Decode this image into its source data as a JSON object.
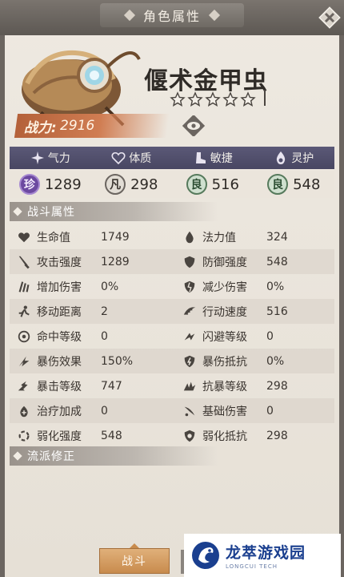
{
  "header": {
    "title": "角色属性"
  },
  "hero": {
    "name": "偃术金甲虫",
    "power_label": "战力:",
    "power_value": "2916",
    "stars_total": 5,
    "stars_filled": 0
  },
  "attributes": {
    "headers": [
      {
        "label": "气力",
        "icon": "spark-icon"
      },
      {
        "label": "体质",
        "icon": "heart-icon"
      },
      {
        "label": "敏捷",
        "icon": "boot-icon"
      },
      {
        "label": "灵护",
        "icon": "flame-drop-icon"
      }
    ],
    "values": [
      {
        "grade": "珍",
        "value": "1289"
      },
      {
        "grade": "凡",
        "value": "298"
      },
      {
        "grade": "良",
        "value": "516"
      },
      {
        "grade": "良",
        "value": "548"
      }
    ]
  },
  "battle_section": {
    "title": "战斗属性"
  },
  "stats": [
    [
      {
        "label": "生命值",
        "value": "1749",
        "icon": "heart-icon"
      },
      {
        "label": "法力值",
        "value": "324",
        "icon": "drop-icon"
      }
    ],
    [
      {
        "label": "攻击强度",
        "value": "1289",
        "icon": "sword-icon"
      },
      {
        "label": "防御强度",
        "value": "548",
        "icon": "shield-icon"
      }
    ],
    [
      {
        "label": "增加伤害",
        "value": "0%",
        "icon": "claw-up-icon"
      },
      {
        "label": "减少伤害",
        "value": "0%",
        "icon": "shield-break-icon"
      }
    ],
    [
      {
        "label": "移动距离",
        "value": "2",
        "icon": "run-icon"
      },
      {
        "label": "行动速度",
        "value": "516",
        "icon": "wing-icon"
      }
    ],
    [
      {
        "label": "命中等级",
        "value": "0",
        "icon": "target-icon"
      },
      {
        "label": "闪避等级",
        "value": "0",
        "icon": "dodge-icon"
      }
    ],
    [
      {
        "label": "暴伤效果",
        "value": "150%",
        "icon": "crit-dmg-icon"
      },
      {
        "label": "暴伤抵抗",
        "value": "0%",
        "icon": "crit-resist-icon"
      }
    ],
    [
      {
        "label": "暴击等级",
        "value": "747",
        "icon": "crit-icon"
      },
      {
        "label": "抗暴等级",
        "value": "298",
        "icon": "anti-crit-icon"
      }
    ],
    [
      {
        "label": "治疗加成",
        "value": "0",
        "icon": "heal-icon"
      },
      {
        "label": "基础伤害",
        "value": "0",
        "icon": "slash-icon"
      }
    ],
    [
      {
        "label": "弱化强度",
        "value": "548",
        "icon": "weaken-icon"
      },
      {
        "label": "弱化抵抗",
        "value": "298",
        "icon": "weaken-resist-icon"
      }
    ]
  ],
  "faction_section": {
    "title": "流派修正"
  },
  "bottom": {
    "tab_battle": "战斗"
  },
  "watermark": {
    "name_cn": "龙萃游戏园",
    "name_en": "LONGCUI TECH"
  },
  "colors": {
    "attr_bar": "#4f4d6b",
    "power_banner": "#c4704a",
    "tab_active": "#d39b60"
  }
}
